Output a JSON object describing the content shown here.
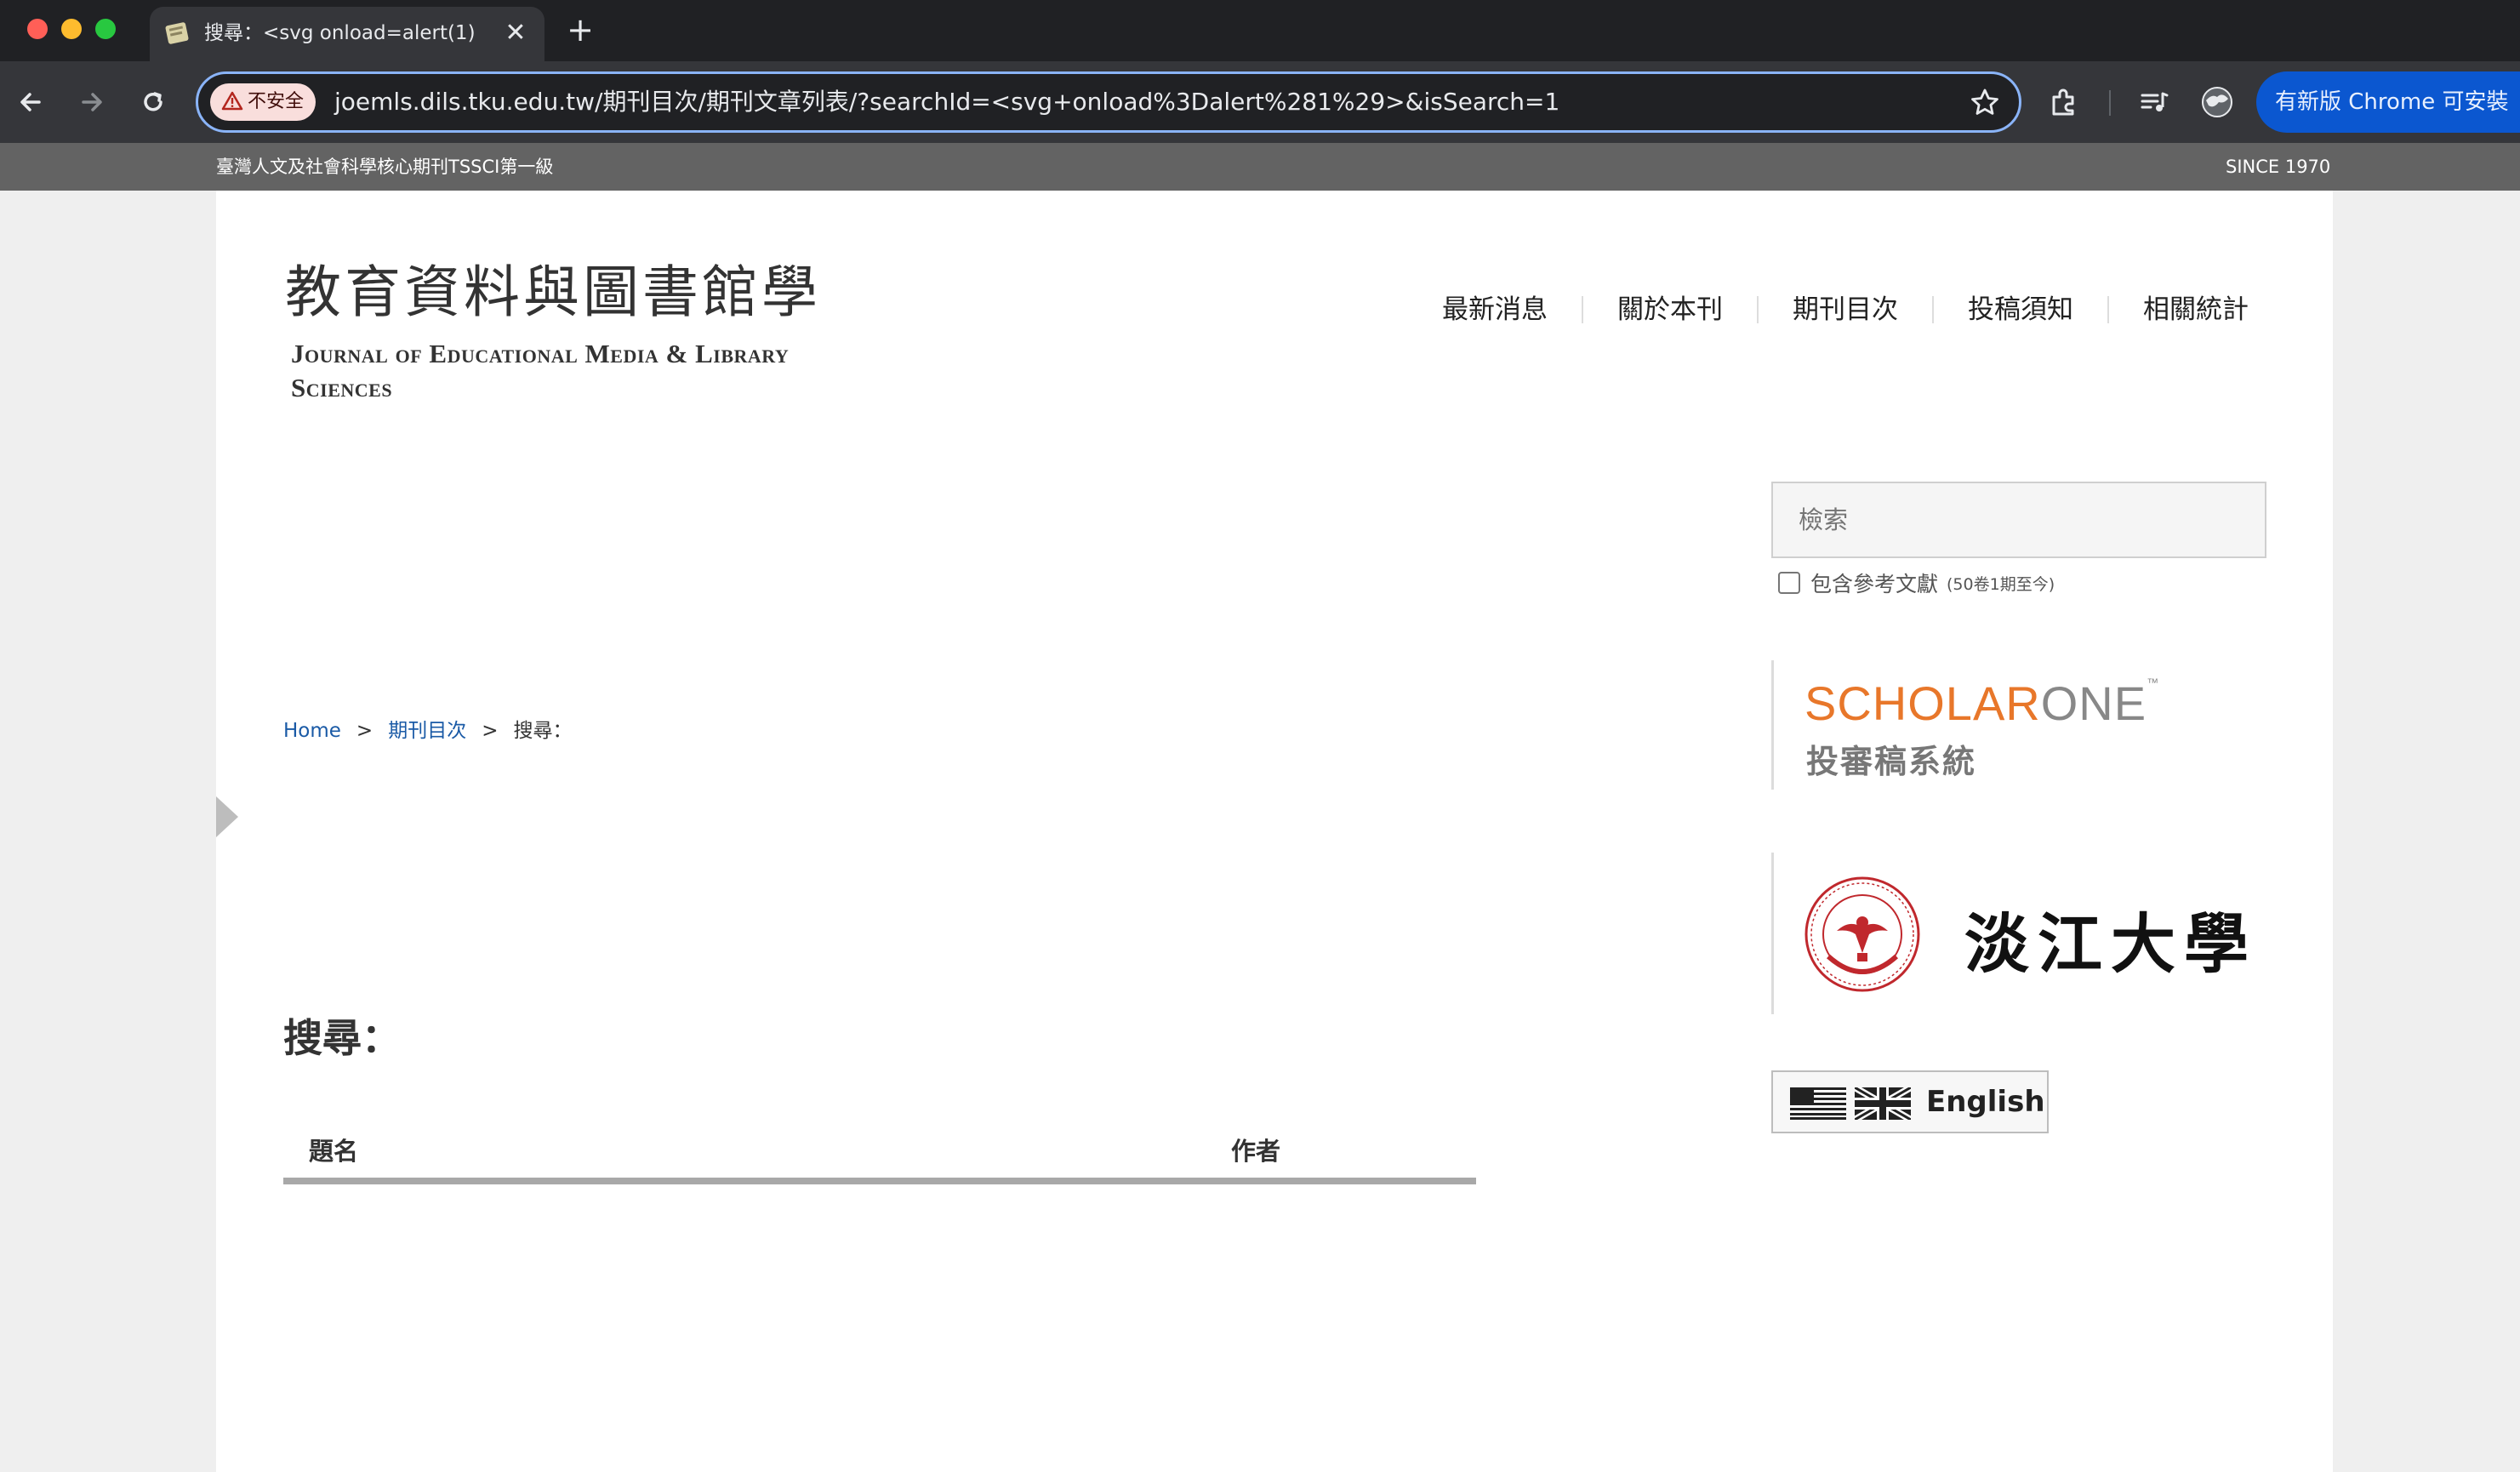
{
  "browser": {
    "tab_title": "搜尋：<svg onload=alert(1)>",
    "security_label": "不安全",
    "url_host": "joemls.dils.tku.edu.tw",
    "url_path": "/期刊目次/期刊文章列表/?searchId=<svg+onload%3Dalert%281%29>&isSearch=1",
    "update_button": "有新版 Chrome 可安裝",
    "icons": [
      "back-icon",
      "forward-icon",
      "reload-icon",
      "star-icon",
      "extensions-icon",
      "media-icon",
      "profile-icon",
      "close-icon",
      "plus-icon",
      "warning-icon"
    ]
  },
  "site": {
    "topbar_left": "臺灣人文及社會科學核心期刊TSSCI第一級",
    "topbar_right": "SINCE 1970",
    "logo_cn": "教育資料與圖書館學",
    "logo_en": "Journal of Educational Media & Library Sciences",
    "nav": [
      "最新消息",
      "關於本刊",
      "期刊目次",
      "投稿須知",
      "相關統計"
    ]
  },
  "breadcrumb": {
    "home": "Home",
    "sep1": ">",
    "level1": "期刊目次",
    "sep2": ">",
    "current": "搜尋："
  },
  "main": {
    "heading": "搜尋：",
    "columns": {
      "title": "題名",
      "author": "作者"
    }
  },
  "sidebar": {
    "search_placeholder": "檢索",
    "ref_label": "包含參考文獻",
    "ref_note": "(50卷1期至今)",
    "scholar_logo_a": "SCHOLAR",
    "scholar_logo_b": "ONE",
    "scholar_tm": "™",
    "scholar_sub": "投審稿系統",
    "tku_name": "淡江大學",
    "english_label": "English"
  },
  "colors": {
    "link": "#1a5aa6",
    "scholar_orange": "#e8772a",
    "topbar": "#636363",
    "omnibox_focus": "#8ab4f8"
  }
}
